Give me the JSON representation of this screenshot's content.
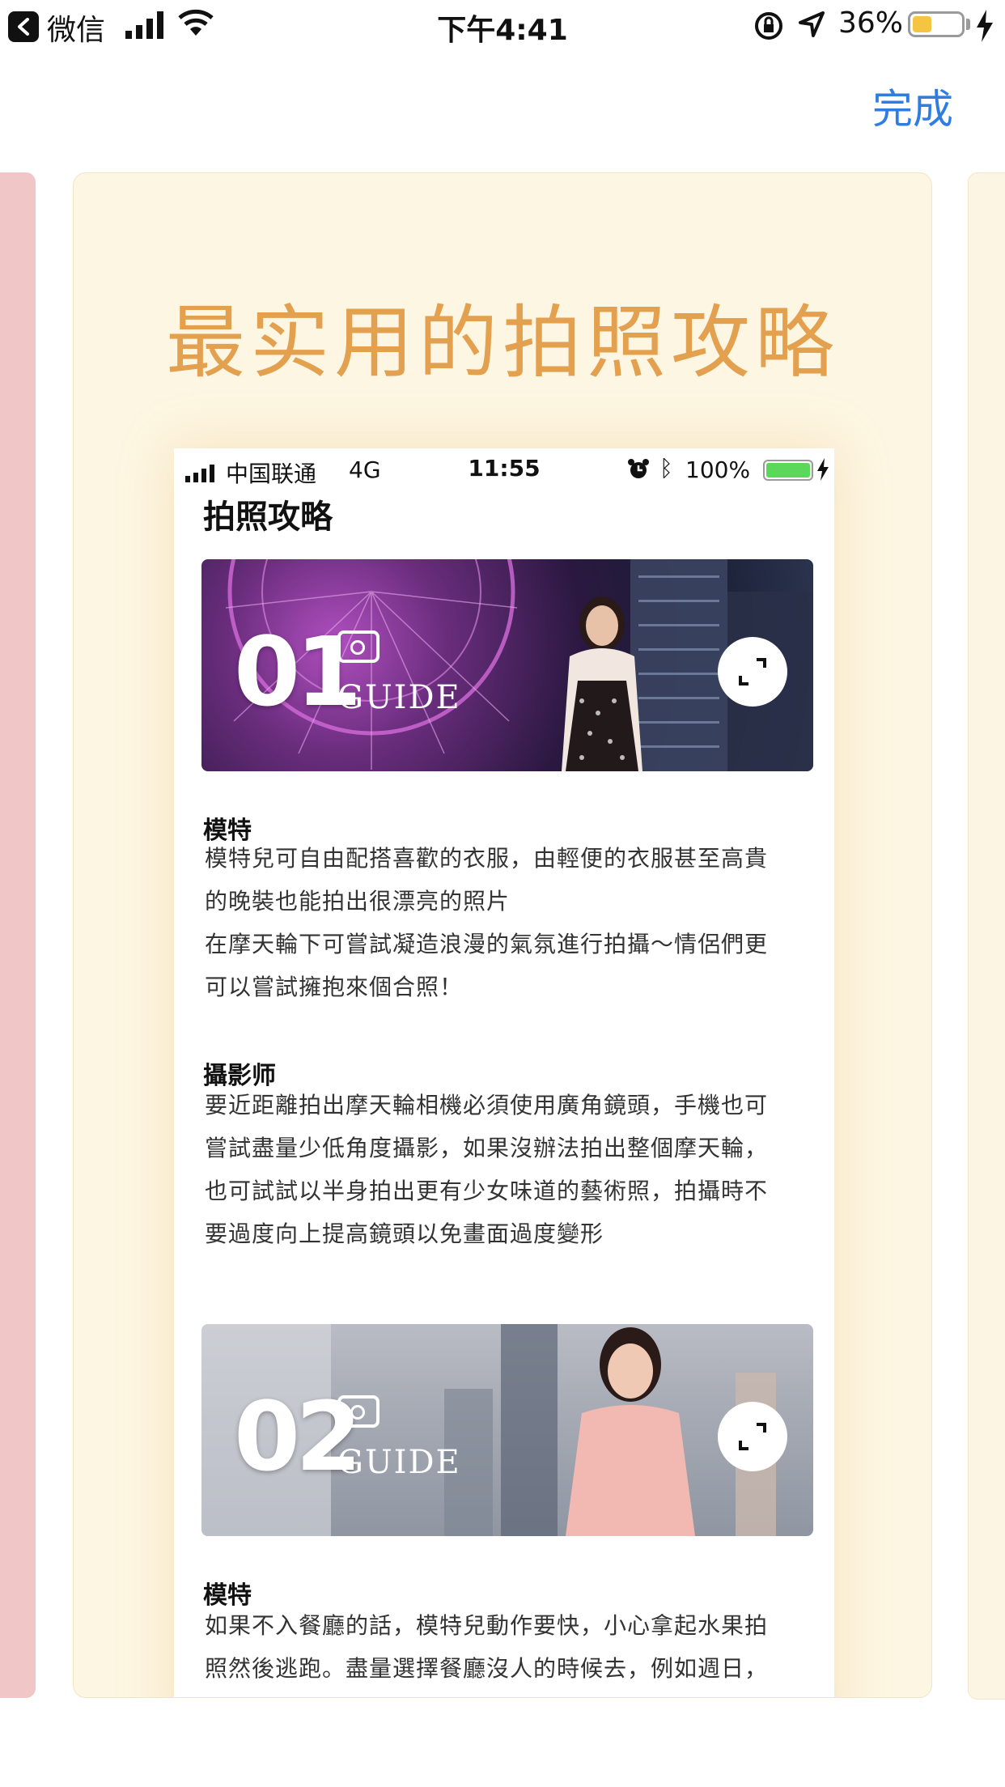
{
  "status_bar": {
    "back_app": "微信",
    "time": "下午4:41",
    "battery_percent": "36%",
    "battery_level": 0.36
  },
  "nav": {
    "done_label": "完成"
  },
  "card": {
    "headline": "最实用的拍照攻略",
    "phone": {
      "status": {
        "carrier": "中国联通",
        "network": "4G",
        "time": "11:55",
        "battery_percent": "100%"
      },
      "page_title": "拍照攻略",
      "guides": [
        {
          "number": "01",
          "word": "GUIDE"
        },
        {
          "number": "02",
          "word": "GUIDE"
        }
      ],
      "sections": [
        {
          "heading": "模特",
          "lines": [
            "模特兒可自由配搭喜歡的衣服，由輕便的衣服甚至高貴",
            "的晚裝也能拍出很漂亮的照片",
            "在摩天輪下可嘗試凝造浪漫的氣氛進行拍攝～情侶們更",
            "可以嘗試擁抱來個合照！"
          ]
        },
        {
          "heading": "攝影师",
          "lines": [
            "要近距離拍出摩天輪相機必須使用廣角鏡頭，手機也可",
            "嘗試盡量少低角度攝影，如果沒辦法拍出整個摩天輪，",
            "也可試試以半身拍出更有少女味道的藝術照，拍攝時不",
            "要過度向上提高鏡頭以免畫面過度變形"
          ]
        },
        {
          "heading": "模特",
          "lines": [
            "如果不入餐廳的話，模特兒動作要快，小心拿起水果拍",
            "照然後逃跑。盡量選擇餐廳沒人的時候去，例如週日，"
          ]
        }
      ]
    }
  },
  "colors": {
    "done_blue": "#2f7de1",
    "headline_orange": "#e3a04f",
    "card_bg": "#fdf6e2",
    "highlight": "#f39a78",
    "prev_card": "#f1c6c6"
  }
}
